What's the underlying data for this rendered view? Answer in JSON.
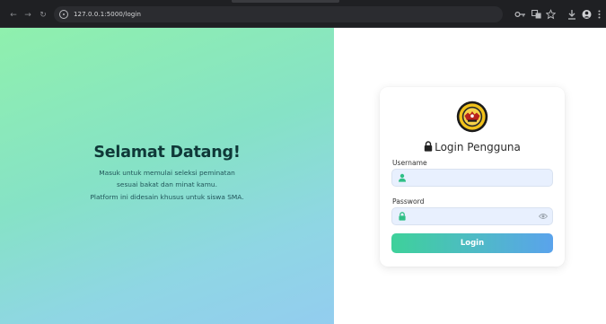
{
  "browser": {
    "nav": {
      "back": "←",
      "forward": "→",
      "reload": "↻"
    },
    "url": "127.0.0.1:5000/login"
  },
  "hero": {
    "title": "Selamat Datang!",
    "line1": "Masuk untuk memulai seleksi peminatan",
    "line2": "sesuai bakat dan minat kamu.",
    "line3": "Platform ini didesain khusus untuk siswa SMA."
  },
  "login": {
    "title": "Login Pengguna",
    "username_label": "Username",
    "username_value": "",
    "password_label": "Password",
    "password_value": "",
    "submit_label": "Login"
  },
  "colors": {
    "accent_green": "#3ed19a",
    "accent_blue": "#5aa3ec",
    "icon_green": "#2fbf86"
  }
}
